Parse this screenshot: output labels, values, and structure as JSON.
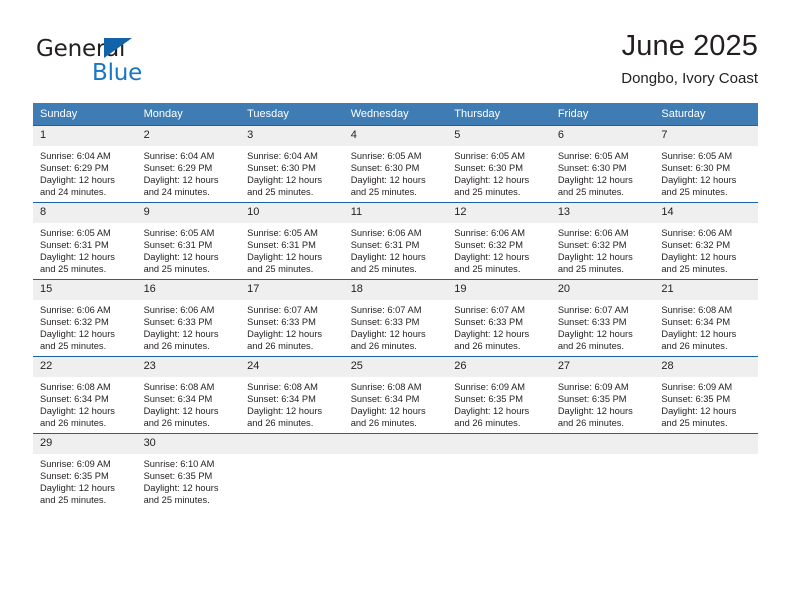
{
  "logo": {
    "word_one": "General",
    "word_two": "Blue",
    "triangle_color": "#1263a8",
    "blue_text_color": "#1877c4"
  },
  "header": {
    "title": "June 2025",
    "subtitle": "Dongbo, Ivory Coast"
  },
  "theme": {
    "header_blue": "#3f7cb4",
    "row_rule_blue": "#1763a5",
    "daynum_band": "#efefef",
    "text": "#231f20"
  },
  "calendar": {
    "weekday_headers": [
      "Sunday",
      "Monday",
      "Tuesday",
      "Wednesday",
      "Thursday",
      "Friday",
      "Saturday"
    ],
    "weeks": [
      [
        {
          "day": "1",
          "sunrise": "Sunrise: 6:04 AM",
          "sunset": "Sunset: 6:29 PM",
          "daylight_line1": "Daylight: 12 hours",
          "daylight_line2": "and 24 minutes."
        },
        {
          "day": "2",
          "sunrise": "Sunrise: 6:04 AM",
          "sunset": "Sunset: 6:29 PM",
          "daylight_line1": "Daylight: 12 hours",
          "daylight_line2": "and 24 minutes."
        },
        {
          "day": "3",
          "sunrise": "Sunrise: 6:04 AM",
          "sunset": "Sunset: 6:30 PM",
          "daylight_line1": "Daylight: 12 hours",
          "daylight_line2": "and 25 minutes."
        },
        {
          "day": "4",
          "sunrise": "Sunrise: 6:05 AM",
          "sunset": "Sunset: 6:30 PM",
          "daylight_line1": "Daylight: 12 hours",
          "daylight_line2": "and 25 minutes."
        },
        {
          "day": "5",
          "sunrise": "Sunrise: 6:05 AM",
          "sunset": "Sunset: 6:30 PM",
          "daylight_line1": "Daylight: 12 hours",
          "daylight_line2": "and 25 minutes."
        },
        {
          "day": "6",
          "sunrise": "Sunrise: 6:05 AM",
          "sunset": "Sunset: 6:30 PM",
          "daylight_line1": "Daylight: 12 hours",
          "daylight_line2": "and 25 minutes."
        },
        {
          "day": "7",
          "sunrise": "Sunrise: 6:05 AM",
          "sunset": "Sunset: 6:30 PM",
          "daylight_line1": "Daylight: 12 hours",
          "daylight_line2": "and 25 minutes."
        }
      ],
      [
        {
          "day": "8",
          "sunrise": "Sunrise: 6:05 AM",
          "sunset": "Sunset: 6:31 PM",
          "daylight_line1": "Daylight: 12 hours",
          "daylight_line2": "and 25 minutes."
        },
        {
          "day": "9",
          "sunrise": "Sunrise: 6:05 AM",
          "sunset": "Sunset: 6:31 PM",
          "daylight_line1": "Daylight: 12 hours",
          "daylight_line2": "and 25 minutes."
        },
        {
          "day": "10",
          "sunrise": "Sunrise: 6:05 AM",
          "sunset": "Sunset: 6:31 PM",
          "daylight_line1": "Daylight: 12 hours",
          "daylight_line2": "and 25 minutes."
        },
        {
          "day": "11",
          "sunrise": "Sunrise: 6:06 AM",
          "sunset": "Sunset: 6:31 PM",
          "daylight_line1": "Daylight: 12 hours",
          "daylight_line2": "and 25 minutes."
        },
        {
          "day": "12",
          "sunrise": "Sunrise: 6:06 AM",
          "sunset": "Sunset: 6:32 PM",
          "daylight_line1": "Daylight: 12 hours",
          "daylight_line2": "and 25 minutes."
        },
        {
          "day": "13",
          "sunrise": "Sunrise: 6:06 AM",
          "sunset": "Sunset: 6:32 PM",
          "daylight_line1": "Daylight: 12 hours",
          "daylight_line2": "and 25 minutes."
        },
        {
          "day": "14",
          "sunrise": "Sunrise: 6:06 AM",
          "sunset": "Sunset: 6:32 PM",
          "daylight_line1": "Daylight: 12 hours",
          "daylight_line2": "and 25 minutes."
        }
      ],
      [
        {
          "day": "15",
          "sunrise": "Sunrise: 6:06 AM",
          "sunset": "Sunset: 6:32 PM",
          "daylight_line1": "Daylight: 12 hours",
          "daylight_line2": "and 25 minutes."
        },
        {
          "day": "16",
          "sunrise": "Sunrise: 6:06 AM",
          "sunset": "Sunset: 6:33 PM",
          "daylight_line1": "Daylight: 12 hours",
          "daylight_line2": "and 26 minutes."
        },
        {
          "day": "17",
          "sunrise": "Sunrise: 6:07 AM",
          "sunset": "Sunset: 6:33 PM",
          "daylight_line1": "Daylight: 12 hours",
          "daylight_line2": "and 26 minutes."
        },
        {
          "day": "18",
          "sunrise": "Sunrise: 6:07 AM",
          "sunset": "Sunset: 6:33 PM",
          "daylight_line1": "Daylight: 12 hours",
          "daylight_line2": "and 26 minutes."
        },
        {
          "day": "19",
          "sunrise": "Sunrise: 6:07 AM",
          "sunset": "Sunset: 6:33 PM",
          "daylight_line1": "Daylight: 12 hours",
          "daylight_line2": "and 26 minutes."
        },
        {
          "day": "20",
          "sunrise": "Sunrise: 6:07 AM",
          "sunset": "Sunset: 6:33 PM",
          "daylight_line1": "Daylight: 12 hours",
          "daylight_line2": "and 26 minutes."
        },
        {
          "day": "21",
          "sunrise": "Sunrise: 6:08 AM",
          "sunset": "Sunset: 6:34 PM",
          "daylight_line1": "Daylight: 12 hours",
          "daylight_line2": "and 26 minutes."
        }
      ],
      [
        {
          "day": "22",
          "sunrise": "Sunrise: 6:08 AM",
          "sunset": "Sunset: 6:34 PM",
          "daylight_line1": "Daylight: 12 hours",
          "daylight_line2": "and 26 minutes."
        },
        {
          "day": "23",
          "sunrise": "Sunrise: 6:08 AM",
          "sunset": "Sunset: 6:34 PM",
          "daylight_line1": "Daylight: 12 hours",
          "daylight_line2": "and 26 minutes."
        },
        {
          "day": "24",
          "sunrise": "Sunrise: 6:08 AM",
          "sunset": "Sunset: 6:34 PM",
          "daylight_line1": "Daylight: 12 hours",
          "daylight_line2": "and 26 minutes."
        },
        {
          "day": "25",
          "sunrise": "Sunrise: 6:08 AM",
          "sunset": "Sunset: 6:34 PM",
          "daylight_line1": "Daylight: 12 hours",
          "daylight_line2": "and 26 minutes."
        },
        {
          "day": "26",
          "sunrise": "Sunrise: 6:09 AM",
          "sunset": "Sunset: 6:35 PM",
          "daylight_line1": "Daylight: 12 hours",
          "daylight_line2": "and 26 minutes."
        },
        {
          "day": "27",
          "sunrise": "Sunrise: 6:09 AM",
          "sunset": "Sunset: 6:35 PM",
          "daylight_line1": "Daylight: 12 hours",
          "daylight_line2": "and 26 minutes."
        },
        {
          "day": "28",
          "sunrise": "Sunrise: 6:09 AM",
          "sunset": "Sunset: 6:35 PM",
          "daylight_line1": "Daylight: 12 hours",
          "daylight_line2": "and 25 minutes."
        }
      ],
      [
        {
          "day": "29",
          "sunrise": "Sunrise: 6:09 AM",
          "sunset": "Sunset: 6:35 PM",
          "daylight_line1": "Daylight: 12 hours",
          "daylight_line2": "and 25 minutes."
        },
        {
          "day": "30",
          "sunrise": "Sunrise: 6:10 AM",
          "sunset": "Sunset: 6:35 PM",
          "daylight_line1": "Daylight: 12 hours",
          "daylight_line2": "and 25 minutes."
        },
        {
          "day": "",
          "sunrise": "",
          "sunset": "",
          "daylight_line1": "",
          "daylight_line2": ""
        },
        {
          "day": "",
          "sunrise": "",
          "sunset": "",
          "daylight_line1": "",
          "daylight_line2": ""
        },
        {
          "day": "",
          "sunrise": "",
          "sunset": "",
          "daylight_line1": "",
          "daylight_line2": ""
        },
        {
          "day": "",
          "sunrise": "",
          "sunset": "",
          "daylight_line1": "",
          "daylight_line2": ""
        },
        {
          "day": "",
          "sunrise": "",
          "sunset": "",
          "daylight_line1": "",
          "daylight_line2": ""
        }
      ]
    ]
  }
}
